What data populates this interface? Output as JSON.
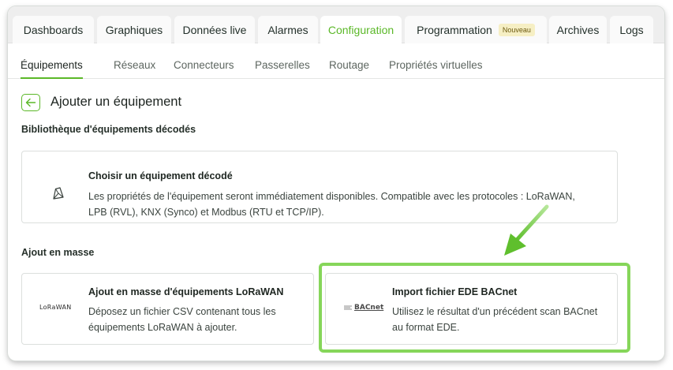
{
  "top_tabs": [
    {
      "label": "Dashboards"
    },
    {
      "label": "Graphiques"
    },
    {
      "label": "Données live"
    },
    {
      "label": "Alarmes"
    },
    {
      "label": "Configuration"
    },
    {
      "label": "Programmation",
      "badge": "Nouveau"
    },
    {
      "label": "Archives"
    },
    {
      "label": "Logs"
    }
  ],
  "active_top_tab": "Configuration",
  "sub_tabs": [
    {
      "label": "Équipements"
    },
    {
      "label": "Réseaux"
    },
    {
      "label": "Connecteurs"
    },
    {
      "label": "Passerelles"
    },
    {
      "label": "Routage"
    },
    {
      "label": "Propriétés virtuelles"
    }
  ],
  "active_sub_tab": "Équipements",
  "page": {
    "title": "Ajouter un équipement",
    "back_icon": "arrow-left-icon"
  },
  "library_section": {
    "title": "Bibliothèque d'équipements décodés",
    "card": {
      "icon": "decoded-device-icon",
      "title": "Choisir un équipement décodé",
      "description": "Les propriétés de l'équipement seront immédiatement disponibles. Compatible avec les protocoles : LoRaWAN, LPB (RVL), KNX (Synco) et Modbus (RTU et TCP/IP)."
    }
  },
  "bulk_section": {
    "title": "Ajout en masse",
    "lorawan_card": {
      "logo_text": "LoRaWAN",
      "title": "Ajout en masse d'équipements LoRaWAN",
      "description": "Déposez un fichier CSV contenant tous les équipements LoRaWAN à ajouter."
    },
    "bacnet_card": {
      "logo_text": "BACnet",
      "title": "Import fichier EDE BACnet",
      "description": "Utilisez le résultat d'un précédent scan BACnet au format EDE."
    }
  },
  "colors": {
    "accent": "#5bb828",
    "highlight": "#86d65a",
    "badge_bg": "#f6efc4"
  }
}
